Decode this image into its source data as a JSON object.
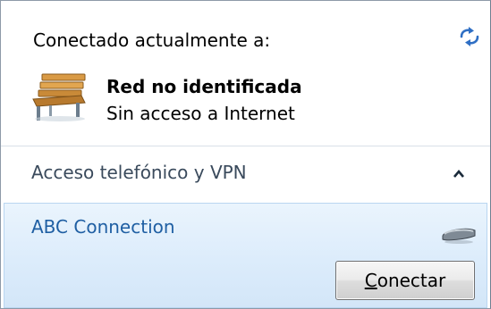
{
  "header": {
    "title": "Conectado actualmente a:",
    "refresh_icon": "refresh-icon"
  },
  "network": {
    "icon": "bench-icon",
    "name": "Red no identificada",
    "status": "Sin acceso a Internet"
  },
  "section": {
    "title": "Acceso telefónico y VPN",
    "caret_icon": "chevron-up-icon",
    "expanded": true
  },
  "connection": {
    "name": "ABC Connection",
    "icon": "modem-icon",
    "button_mnemonic": "C",
    "button_rest": "onectar"
  },
  "colors": {
    "selection_bg": "#dcecfb",
    "selection_border": "#b9d6f1",
    "link_text": "#1f5fa3",
    "section_text": "#3a4a5c"
  }
}
